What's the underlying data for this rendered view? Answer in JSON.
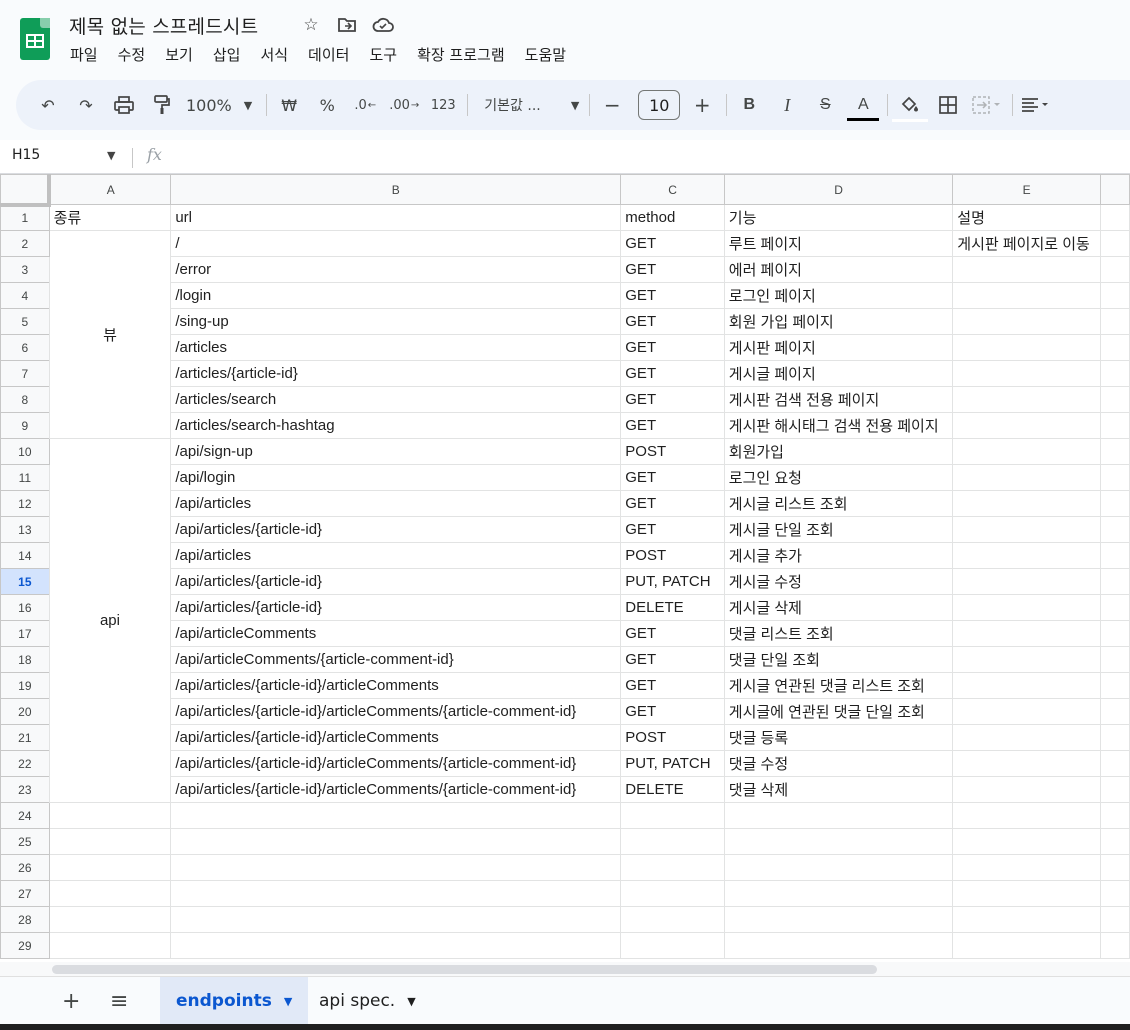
{
  "title_bar": {
    "doc_title": "제목 없는 스프레드시트",
    "icons": [
      "star-icon",
      "move-to-folder-icon",
      "cloud-status-icon"
    ]
  },
  "menu": [
    "파일",
    "수정",
    "보기",
    "삽입",
    "서식",
    "데이터",
    "도구",
    "확장 프로그램",
    "도움말"
  ],
  "toolbar": {
    "zoom": "100%",
    "currency": "₩",
    "percent": "%",
    "dec_decrease": ".0",
    "dec_increase": ".00",
    "number_format": "123",
    "font": "기본값 ...",
    "font_size": "10",
    "bold": "B",
    "italic": "I",
    "text_color": "A"
  },
  "formula_bar": {
    "name_box": "H15",
    "fx": "fx",
    "content": ""
  },
  "grid": {
    "columns": [
      "A",
      "B",
      "C",
      "D",
      "E"
    ],
    "header": [
      "종류",
      "url",
      "method",
      "기능",
      "설명"
    ],
    "group_view": "뷰",
    "group_api": "api",
    "active_row": 15,
    "rows": [
      [
        "/",
        "GET",
        "루트 페이지",
        "게시판 페이지로 이동"
      ],
      [
        "/error",
        "GET",
        "에러 페이지",
        ""
      ],
      [
        "/login",
        "GET",
        "로그인 페이지",
        ""
      ],
      [
        "/sing-up",
        "GET",
        "회원 가입 페이지",
        ""
      ],
      [
        "/articles",
        "GET",
        "게시판 페이지",
        ""
      ],
      [
        "/articles/{article-id}",
        "GET",
        "게시글 페이지",
        ""
      ],
      [
        "/articles/search",
        "GET",
        "게시판 검색 전용 페이지",
        ""
      ],
      [
        "/articles/search-hashtag",
        "GET",
        "게시판 해시태그 검색 전용 페이지",
        ""
      ],
      [
        "/api/sign-up",
        "POST",
        "회원가입",
        ""
      ],
      [
        "/api/login",
        "GET",
        "로그인 요청",
        ""
      ],
      [
        "/api/articles",
        "GET",
        "게시글 리스트 조회",
        ""
      ],
      [
        "/api/articles/{article-id}",
        " GET",
        "게시글 단일 조회",
        ""
      ],
      [
        "/api/articles",
        "POST",
        "게시글 추가",
        ""
      ],
      [
        "/api/articles/{article-id}",
        "PUT, PATCH",
        "게시글 수정",
        ""
      ],
      [
        "/api/articles/{article-id}",
        "DELETE",
        "게시글 삭제",
        ""
      ],
      [
        "/api/articleComments",
        "GET",
        "댓글 리스트 조회",
        ""
      ],
      [
        "/api/articleComments/{article-comment-id}",
        "GET",
        "댓글 단일 조회",
        ""
      ],
      [
        "/api/articles/{article-id}/articleComments",
        "GET",
        " 게시글 연관된 댓글 리스트 조회",
        ""
      ],
      [
        "/api/articles/{article-id}/articleComments/{article-comment-id}",
        "GET",
        "게시글에 연관된 댓글 단일 조회",
        ""
      ],
      [
        "/api/articles/{article-id}/articleComments",
        "POST",
        "댓글 등록",
        ""
      ],
      [
        "/api/articles/{article-id}/articleComments/{article-comment-id}",
        "PUT, PATCH",
        "댓글 수정",
        ""
      ],
      [
        "/api/articles/{article-id}/articleComments/{article-comment-id}",
        "DELETE",
        "댓글 삭제",
        ""
      ]
    ],
    "empty_rows": [
      24,
      25,
      26,
      27,
      28,
      29
    ]
  },
  "sheet_tabs": [
    {
      "label": "endpoints",
      "active": true
    },
    {
      "label": "api spec.",
      "active": false
    }
  ]
}
